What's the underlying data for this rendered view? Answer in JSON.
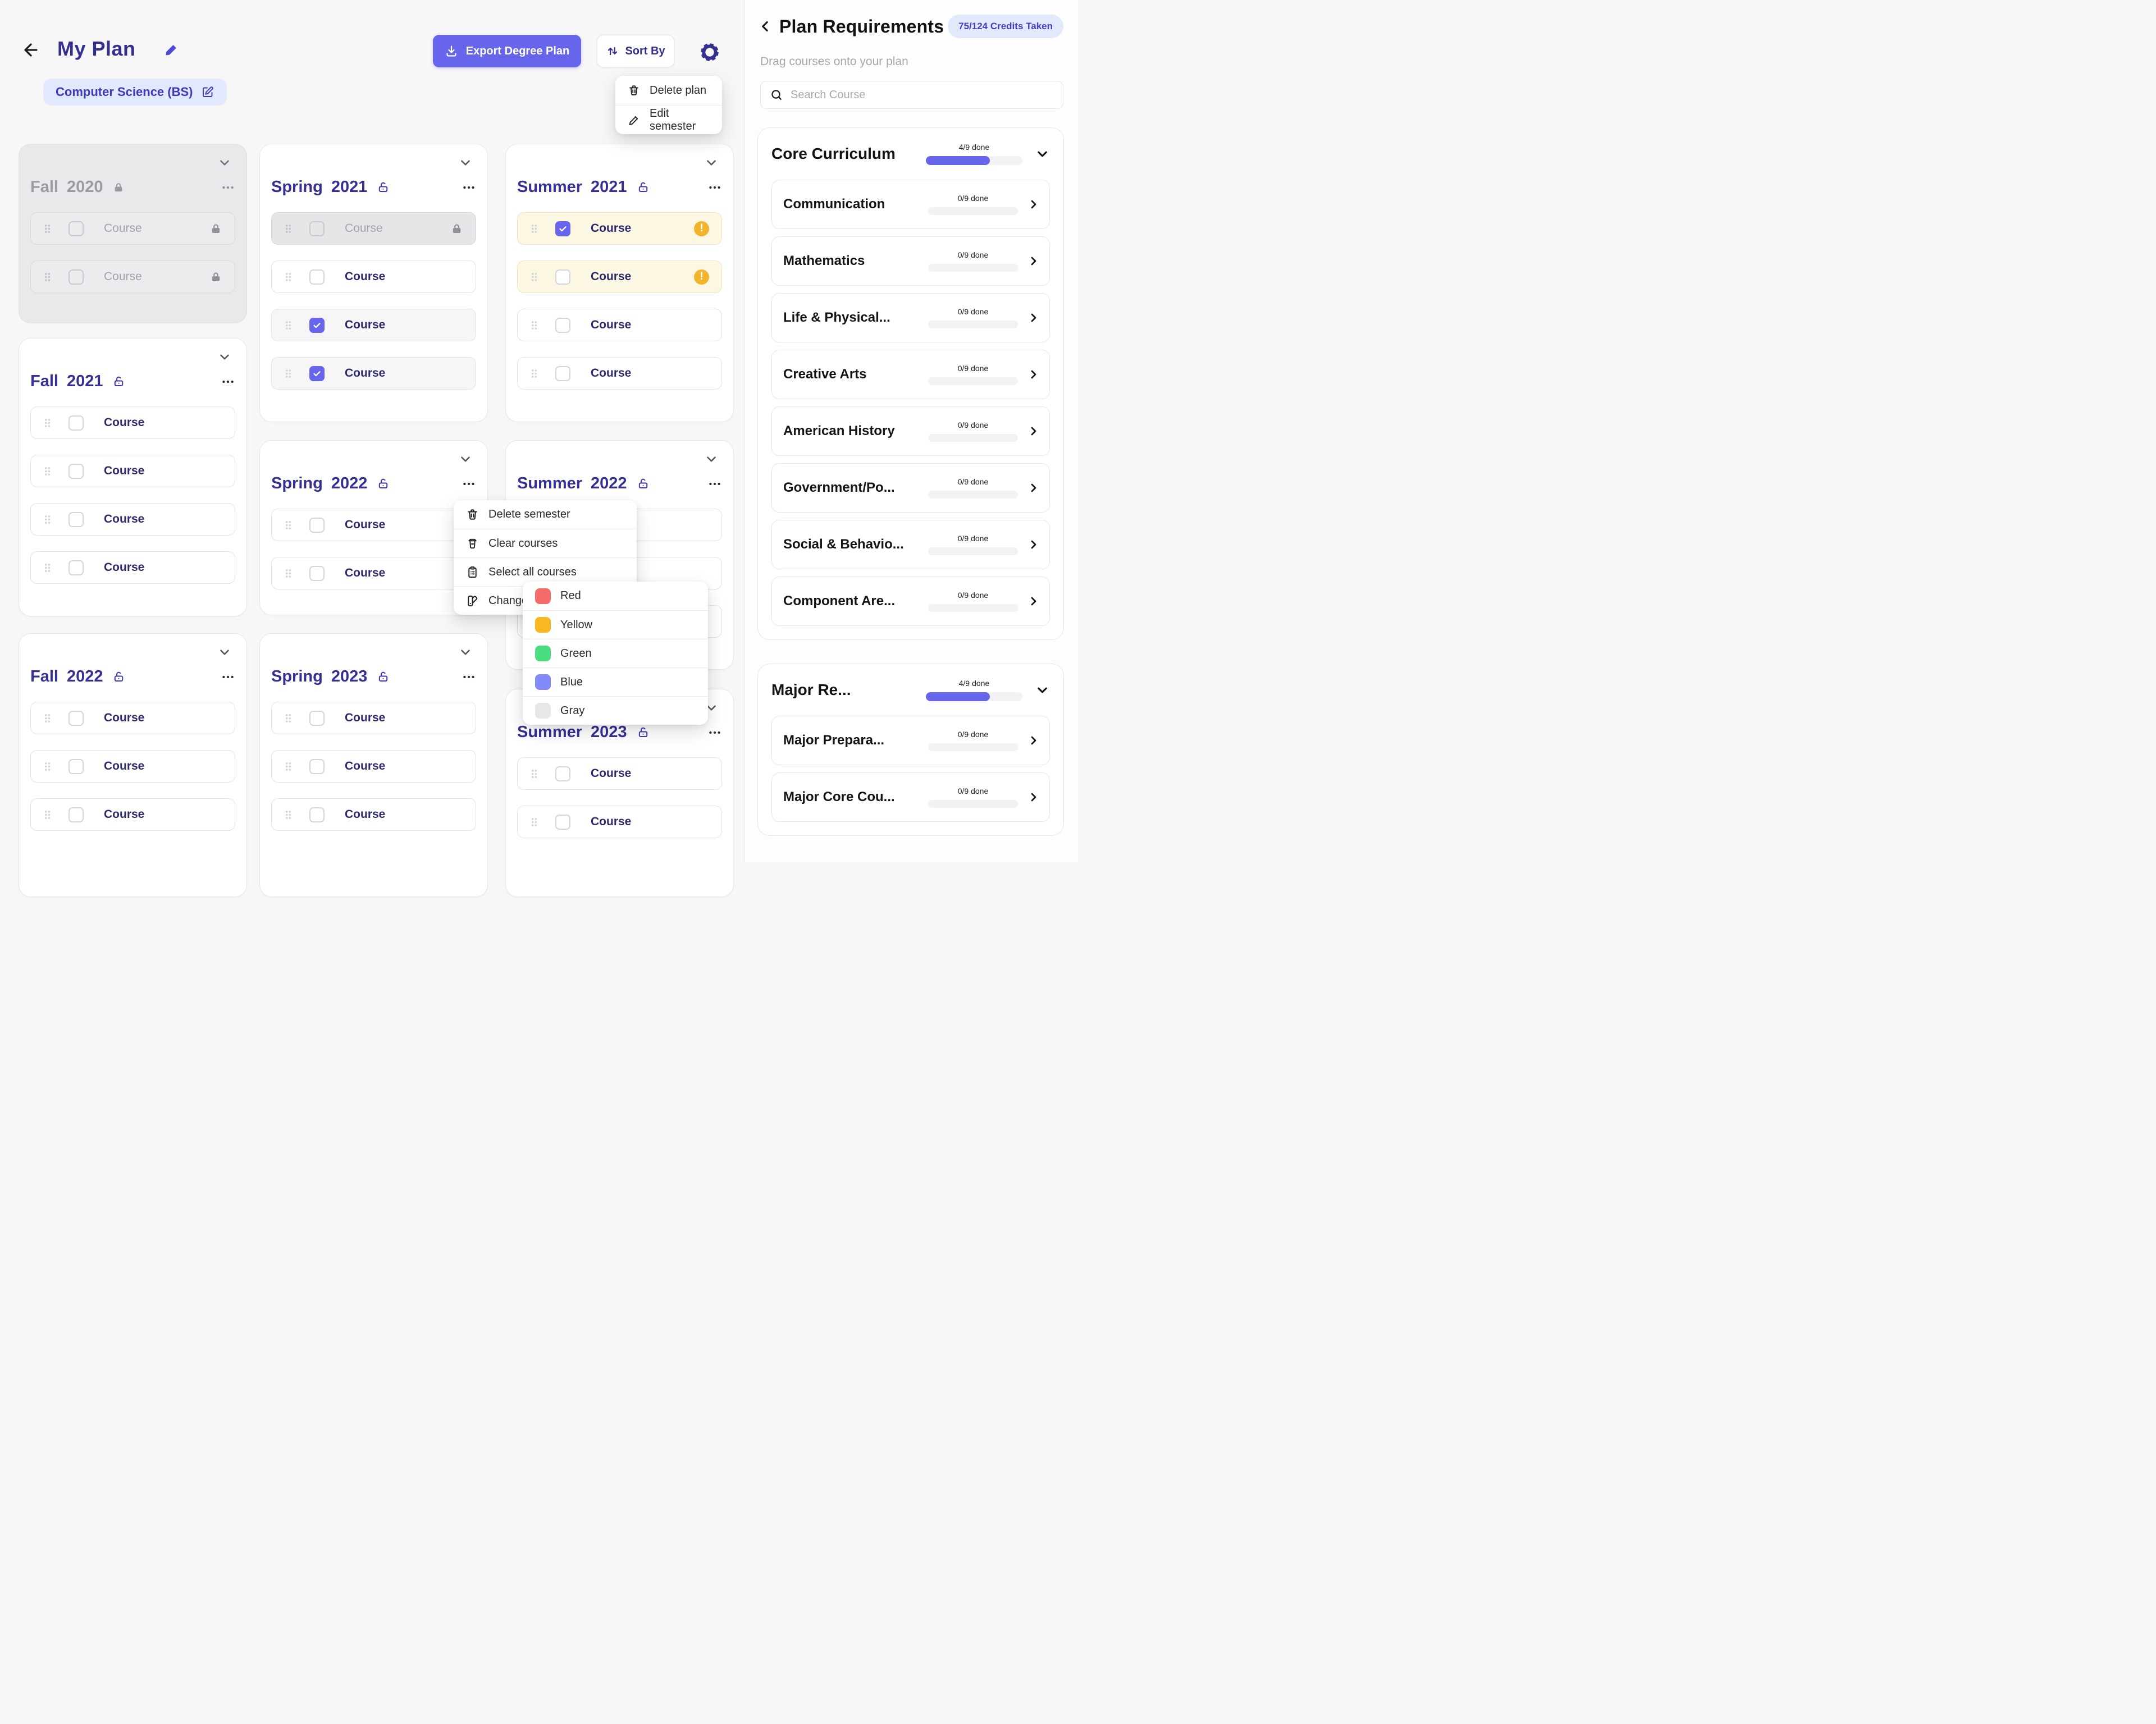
{
  "header": {
    "title": "My Plan",
    "program_badge": "Computer Science (BS)",
    "export_label": "Export Degree Plan",
    "sort_label": "Sort By"
  },
  "gear_menu": {
    "items": [
      {
        "icon": "trash-icon",
        "label": "Delete plan"
      },
      {
        "icon": "pencil-icon",
        "label": "Edit semester"
      }
    ]
  },
  "context_menu": {
    "items": [
      {
        "icon": "trash-icon",
        "label": "Delete semester"
      },
      {
        "icon": "clear-icon",
        "label": "Clear courses"
      },
      {
        "icon": "clipboard-icon",
        "label": "Select all courses"
      },
      {
        "icon": "palette-icon",
        "label": "Change color"
      }
    ]
  },
  "color_menu": {
    "items": [
      {
        "name": "Red",
        "hex": "#f56b6b"
      },
      {
        "name": "Yellow",
        "hex": "#f7b822"
      },
      {
        "name": "Green",
        "hex": "#4ade80"
      },
      {
        "name": "Blue",
        "hex": "#818af8"
      },
      {
        "name": "Gray",
        "hex": "#e7e7e9"
      }
    ]
  },
  "accent_colors": {
    "primary": "#6765ec",
    "title_indigo": "#33308f",
    "warning": "#f2b42a"
  },
  "semesters": [
    {
      "season": "Fall",
      "year": "2020",
      "locked": true,
      "courses": [
        {
          "label": "Course",
          "state": "locked"
        },
        {
          "label": "Course",
          "state": "locked"
        }
      ]
    },
    {
      "season": "Spring",
      "year": "2021",
      "locked": false,
      "courses": [
        {
          "label": "Course",
          "state": "locked"
        },
        {
          "label": "Course",
          "state": "unchecked"
        },
        {
          "label": "Course",
          "state": "checked"
        },
        {
          "label": "Course",
          "state": "checked"
        }
      ]
    },
    {
      "season": "Summer",
      "year": "2021",
      "locked": false,
      "courses": [
        {
          "label": "Course",
          "state": "checked-warning"
        },
        {
          "label": "Course",
          "state": "unchecked-warning"
        },
        {
          "label": "Course",
          "state": "unchecked"
        },
        {
          "label": "Course",
          "state": "unchecked"
        }
      ]
    },
    {
      "season": "Fall",
      "year": "2021",
      "locked": false,
      "courses": [
        {
          "label": "Course",
          "state": "unchecked"
        },
        {
          "label": "Course",
          "state": "unchecked"
        },
        {
          "label": "Course",
          "state": "unchecked"
        },
        {
          "label": "Course",
          "state": "unchecked"
        }
      ]
    },
    {
      "season": "Spring",
      "year": "2022",
      "locked": false,
      "courses": [
        {
          "label": "Course",
          "state": "unchecked"
        },
        {
          "label": "Course",
          "state": "unchecked"
        }
      ]
    },
    {
      "season": "Summer",
      "year": "2022",
      "locked": false,
      "courses": [
        {
          "label": "Course",
          "state": "unchecked"
        },
        {
          "label": "Course",
          "state": "unchecked"
        },
        {
          "label": "Course",
          "state": "unchecked"
        }
      ]
    },
    {
      "season": "Fall",
      "year": "2022",
      "locked": false,
      "courses": [
        {
          "label": "Course",
          "state": "unchecked"
        },
        {
          "label": "Course",
          "state": "unchecked"
        },
        {
          "label": "Course",
          "state": "unchecked"
        }
      ]
    },
    {
      "season": "Spring",
      "year": "2023",
      "locked": false,
      "courses": [
        {
          "label": "Course",
          "state": "unchecked"
        },
        {
          "label": "Course",
          "state": "unchecked"
        },
        {
          "label": "Course",
          "state": "unchecked"
        }
      ]
    },
    {
      "season": "Summer",
      "year": "2023",
      "locked": false,
      "courses": [
        {
          "label": "Course",
          "state": "unchecked"
        },
        {
          "label": "Course",
          "state": "unchecked"
        }
      ]
    }
  ],
  "sidebar": {
    "title": "Plan Requirements",
    "credits_badge": "75/124 Credits Taken",
    "hint": "Drag courses onto your plan",
    "search_placeholder": "Search Course",
    "sections": [
      {
        "title": "Core Curriculum",
        "progress": "4/9 done",
        "fill_pct": 66,
        "items": [
          {
            "name": "Communication",
            "progress": "0/9 done",
            "fill_pct": 0
          },
          {
            "name": "Mathematics",
            "progress": "0/9 done",
            "fill_pct": 0
          },
          {
            "name": "Life & Physical...",
            "progress": "0/9 done",
            "fill_pct": 0
          },
          {
            "name": "Creative Arts",
            "progress": "0/9 done",
            "fill_pct": 0
          },
          {
            "name": "American History",
            "progress": "0/9 done",
            "fill_pct": 0
          },
          {
            "name": "Government/Po...",
            "progress": "0/9 done",
            "fill_pct": 0
          },
          {
            "name": "Social & Behavio...",
            "progress": "0/9 done",
            "fill_pct": 0
          },
          {
            "name": "Component Are...",
            "progress": "0/9 done",
            "fill_pct": 0
          }
        ]
      },
      {
        "title": "Major  Re...",
        "progress": "4/9 done",
        "fill_pct": 66,
        "items": [
          {
            "name": "Major Prepara...",
            "progress": "0/9 done",
            "fill_pct": 0
          },
          {
            "name": "Major Core Cou...",
            "progress": "0/9 done",
            "fill_pct": 0
          }
        ]
      }
    ]
  }
}
